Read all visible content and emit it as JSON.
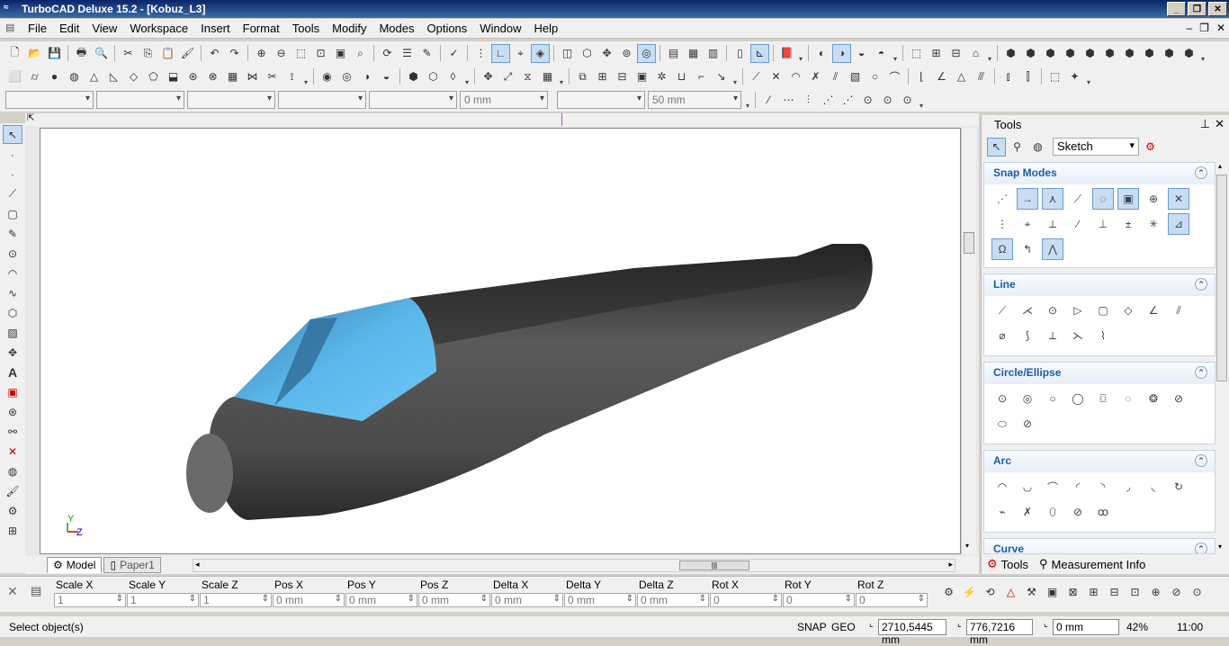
{
  "window": {
    "title": "TurboCAD Deluxe 15.2 - [Kobuz_L3]"
  },
  "menu": [
    "File",
    "Edit",
    "View",
    "Workspace",
    "Insert",
    "Format",
    "Tools",
    "Modify",
    "Modes",
    "Options",
    "Window",
    "Help"
  ],
  "toolbar3": {
    "combo_offset": "0 mm",
    "combo_size": "50 mm"
  },
  "tabs": {
    "model": "Model",
    "paper": "Paper1"
  },
  "panel": {
    "title": "Tools",
    "mode": "Sketch",
    "sections": [
      {
        "title": "Snap Modes",
        "count": 19
      },
      {
        "title": "Line",
        "count": 13
      },
      {
        "title": "Circle/Ellipse",
        "count": 10
      },
      {
        "title": "Arc",
        "count": 13
      },
      {
        "title": "Curve"
      }
    ],
    "bottom_tabs": [
      "Tools",
      "Measurement Info"
    ]
  },
  "coords": [
    {
      "label": "Scale X",
      "value": "1"
    },
    {
      "label": "Scale Y",
      "value": "1"
    },
    {
      "label": "Scale Z",
      "value": "1"
    },
    {
      "label": "Pos X",
      "value": "0 mm"
    },
    {
      "label": "Pos Y",
      "value": "0 mm"
    },
    {
      "label": "Pos Z",
      "value": "0 mm"
    },
    {
      "label": "Delta X",
      "value": "0 mm"
    },
    {
      "label": "Delta Y",
      "value": "0 mm"
    },
    {
      "label": "Delta Z",
      "value": "0 mm"
    },
    {
      "label": "Rot X",
      "value": "0"
    },
    {
      "label": "Rot Y",
      "value": "0"
    },
    {
      "label": "Rot Z",
      "value": "0"
    }
  ],
  "status": {
    "message": "Select object(s)",
    "snap": "SNAP",
    "geo": "GEO",
    "x": "2710,5445 mm",
    "y": "776,7216 mm",
    "z": "0 mm",
    "zoom": "42%",
    "time": "11:00"
  },
  "axis": {
    "y": "Y",
    "z": "Z"
  },
  "colors": {
    "fuselage": "#555555",
    "canopy": "#4ab8f0",
    "titlebar": "#0a246a"
  }
}
